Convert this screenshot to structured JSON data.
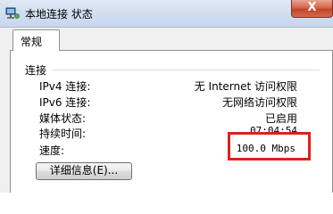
{
  "window": {
    "title": "本地连接 状态",
    "close_glyph": "X"
  },
  "tabs": [
    {
      "label": "常规"
    }
  ],
  "connection": {
    "group_title": "连接",
    "rows": [
      {
        "label": "IPv4 连接:",
        "value": "无 Internet 访问权限"
      },
      {
        "label": "IPv6 连接:",
        "value": "无网络访问权限"
      },
      {
        "label": "媒体状态:",
        "value": "已启用"
      },
      {
        "label": "持续时间:",
        "value": "07:04:54"
      },
      {
        "label": "速度:",
        "value": "100.0 Mbps"
      }
    ],
    "details_button": "详细信息(E)..."
  },
  "colors": {
    "highlight": "#e0201a",
    "close_button": "#c2442a"
  },
  "icons": {
    "app_icon": "network-connection-icon",
    "close": "close-icon"
  }
}
